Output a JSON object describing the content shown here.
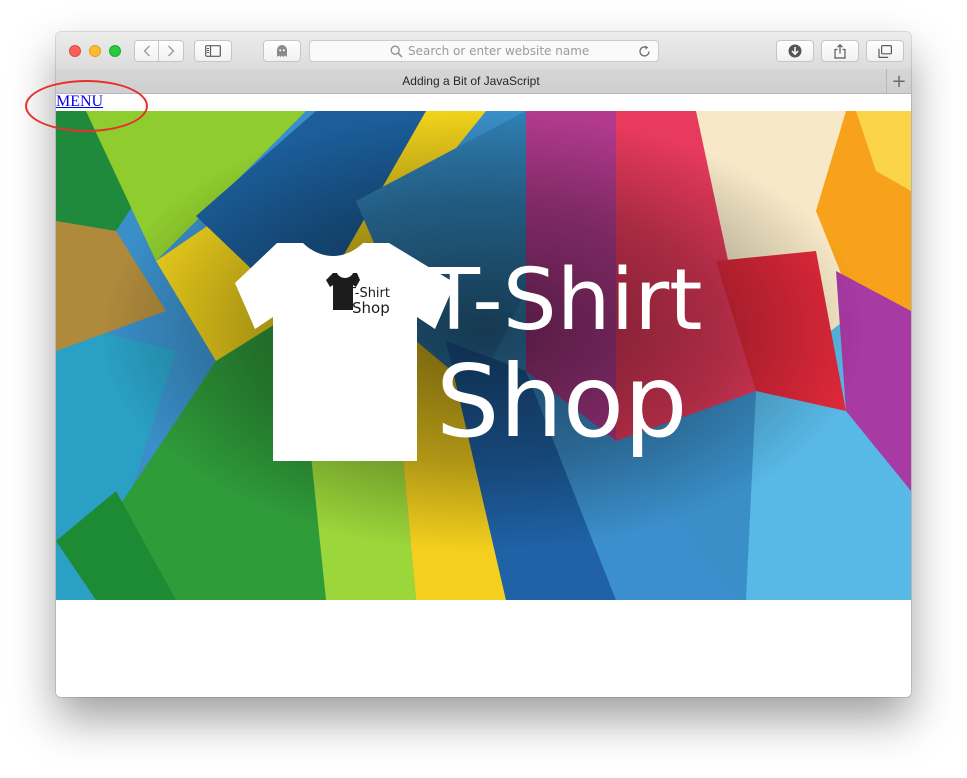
{
  "browser": {
    "address_placeholder": "Search or enter website name",
    "tab_title": "Adding a Bit of JavaScript",
    "new_tab_symbol": "+"
  },
  "page": {
    "menu_label": "MENU",
    "hero": {
      "title_line1": "T-Shirt",
      "title_line2": "Shop",
      "logo_line1": "T-Shirt",
      "logo_line2": "Shop"
    }
  },
  "colors": {
    "link": "#0000ee",
    "annotation_circle": "#e5322d",
    "traffic_red": "#fc5f57",
    "traffic_yellow": "#fdbc2e",
    "traffic_green": "#28c840"
  },
  "icons": [
    "back-icon",
    "forward-icon",
    "sidebar-icon",
    "ghost-icon",
    "search-icon",
    "reload-icon",
    "download-icon",
    "share-icon",
    "tabs-icon",
    "tshirt-icon"
  ]
}
